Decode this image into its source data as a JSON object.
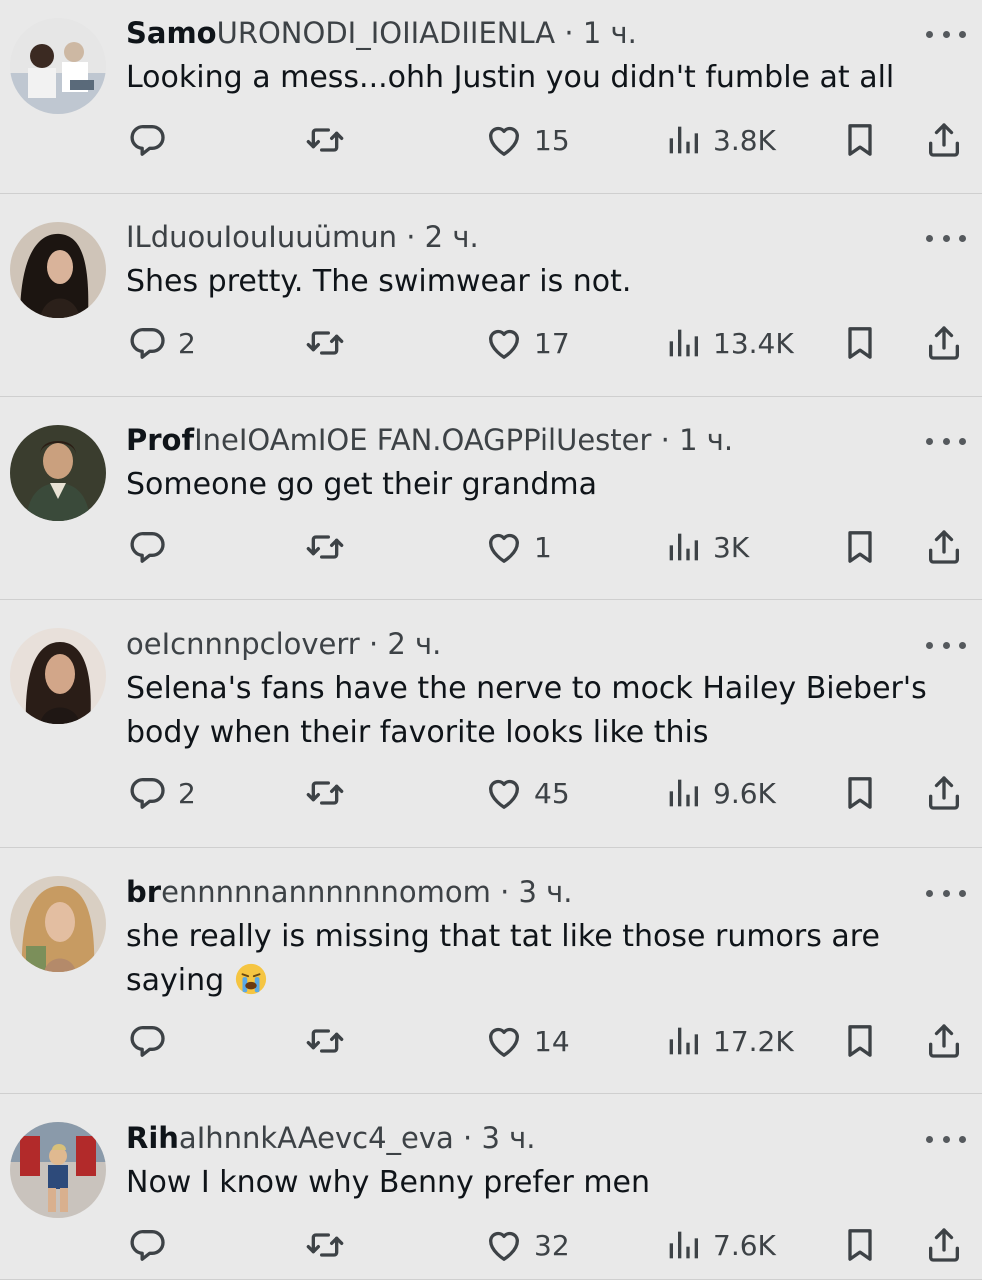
{
  "posts": [
    {
      "name": "Samo",
      "handle": "URONODI_IOIIADIIENLA",
      "time": "1 ч.",
      "text": "Looking a mess...ohh Justin you didn't fumble at all",
      "emoji": "",
      "replies": "",
      "likes": "15",
      "views": "3.8K"
    },
    {
      "name": "",
      "handle": "ILduouIouIuuümun",
      "time": "2 ч.",
      "text": "Shes pretty. The swimwear is not.",
      "emoji": "",
      "replies": "2",
      "likes": "17",
      "views": "13.4K"
    },
    {
      "name": "Prof",
      "handle": "IneIOAmIOE FAN.OAGPPilUester",
      "time": "1 ч.",
      "text": "Someone go get their grandma",
      "emoji": "",
      "replies": "",
      "likes": "1",
      "views": "3K"
    },
    {
      "name": "",
      "handle": "oeIcnnnpcloverr",
      "time": "2 ч.",
      "text": "Selena's fans have the nerve to mock Hailey Bieber's body when their favorite looks like this",
      "emoji": "",
      "replies": "2",
      "likes": "45",
      "views": "9.6K"
    },
    {
      "name": "br",
      "handle": "ennnnnannnnnnomom",
      "time": "3 ч.",
      "text": "she really is missing that tat like those rumors are saying",
      "emoji": "loudly-crying-face",
      "replies": "",
      "likes": "14",
      "views": "17.2K"
    },
    {
      "name": "Rih",
      "handle": "aIhnnkAAevc4_eva",
      "time": "3 ч.",
      "text": "Now I know why Benny prefer men",
      "emoji": "",
      "replies": "",
      "likes": "32",
      "views": "7.6K"
    }
  ],
  "ui": {
    "dot": "·"
  },
  "colors": {
    "background": "#e9e9e9",
    "text": "#0f1419",
    "muted": "#3d4246",
    "divider": "#cfcfcf"
  },
  "icons": [
    "reply-icon",
    "retweet-icon",
    "heart-icon",
    "views-icon",
    "bookmark-icon",
    "share-icon",
    "more-icon"
  ]
}
